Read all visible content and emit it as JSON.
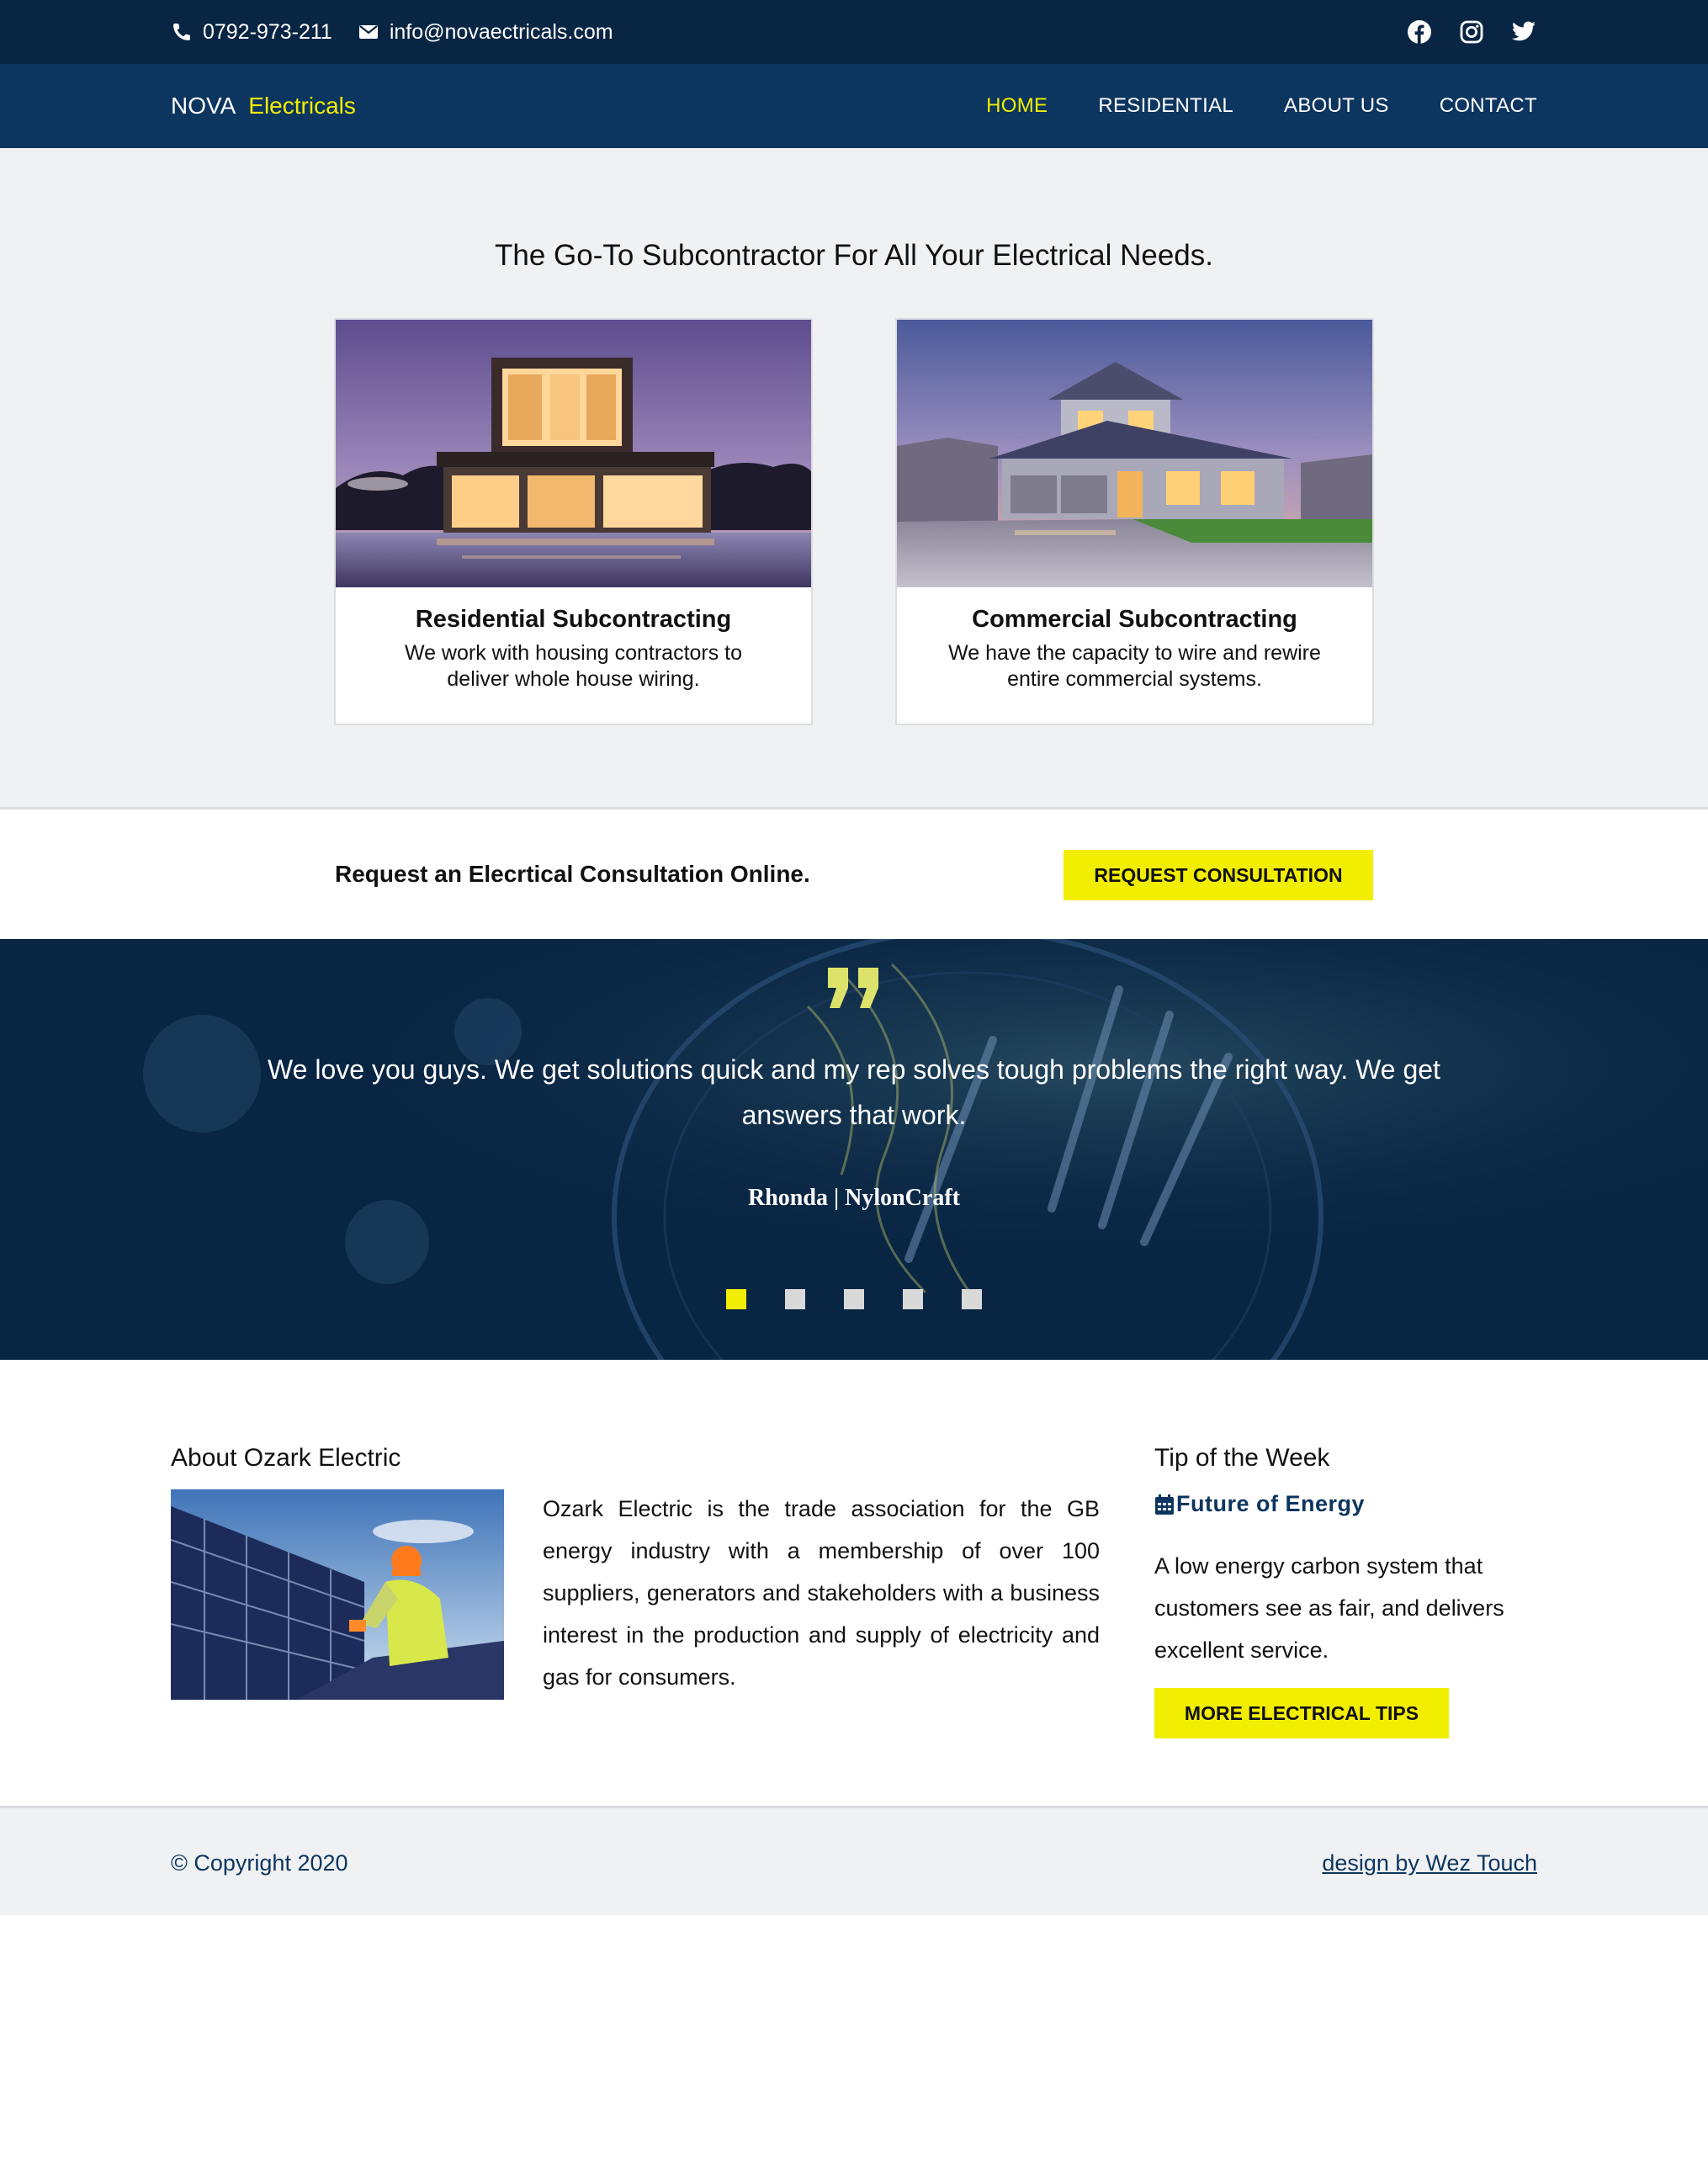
{
  "topbar": {
    "phone": "0792-973-211",
    "email": "info@novaectricals.com",
    "phone_icon": "phone-icon",
    "email_icon": "envelope-icon",
    "social_icons": [
      "facebook-icon",
      "instagram-icon",
      "twitter-icon"
    ]
  },
  "nav": {
    "brand_part1": "NOVA",
    "brand_part2": "Electricals",
    "items": [
      {
        "label": "HOME",
        "active": true
      },
      {
        "label": "RESIDENTIAL",
        "active": false
      },
      {
        "label": "ABOUT US",
        "active": false
      },
      {
        "label": "CONTACT",
        "active": false
      }
    ]
  },
  "services": {
    "heading": "The Go-To Subcontractor For All Your Electrical Needs.",
    "cards": [
      {
        "title": "Residential Subcontracting",
        "text": "We work with housing contractors to deliver whole house wiring."
      },
      {
        "title": "Commercial Subcontracting",
        "text": "We have the capacity to wire and rewire entire commercial systems."
      }
    ]
  },
  "request": {
    "text": "Request an Elecrtical Consultation Online.",
    "button": "REQUEST CONSULTATION"
  },
  "testimonial": {
    "quote_icon": "quote-icon",
    "text": "We love you guys. We get solutions quick and my rep solves tough problems the right way. We get answers that work.",
    "author": "Rhonda | NylonCraft",
    "dots_count": 5,
    "active_dot": 1
  },
  "about": {
    "heading": "About Ozark Electric",
    "text": "Ozark Electric is the trade association for the GB energy industry with a membership of over 100 suppliers, generators and stakeholders with a business interest in the production and supply of electricity and gas for consumers."
  },
  "tip": {
    "heading": "Tip of the Week",
    "subheading": "Future of Energy",
    "sub_icon": "calendar-icon",
    "text": "A low energy carbon system that customers see as fair, and delivers excellent service.",
    "button": "MORE ELECTRICAL TIPS"
  },
  "footer": {
    "copyright": "© Copyright 2020",
    "design": "design by Wez Touch"
  },
  "colors": {
    "navy_dark": "#082543",
    "navy": "#0c355f",
    "accent_yellow": "#f2ee01",
    "light_gray": "#f0f1f3"
  }
}
